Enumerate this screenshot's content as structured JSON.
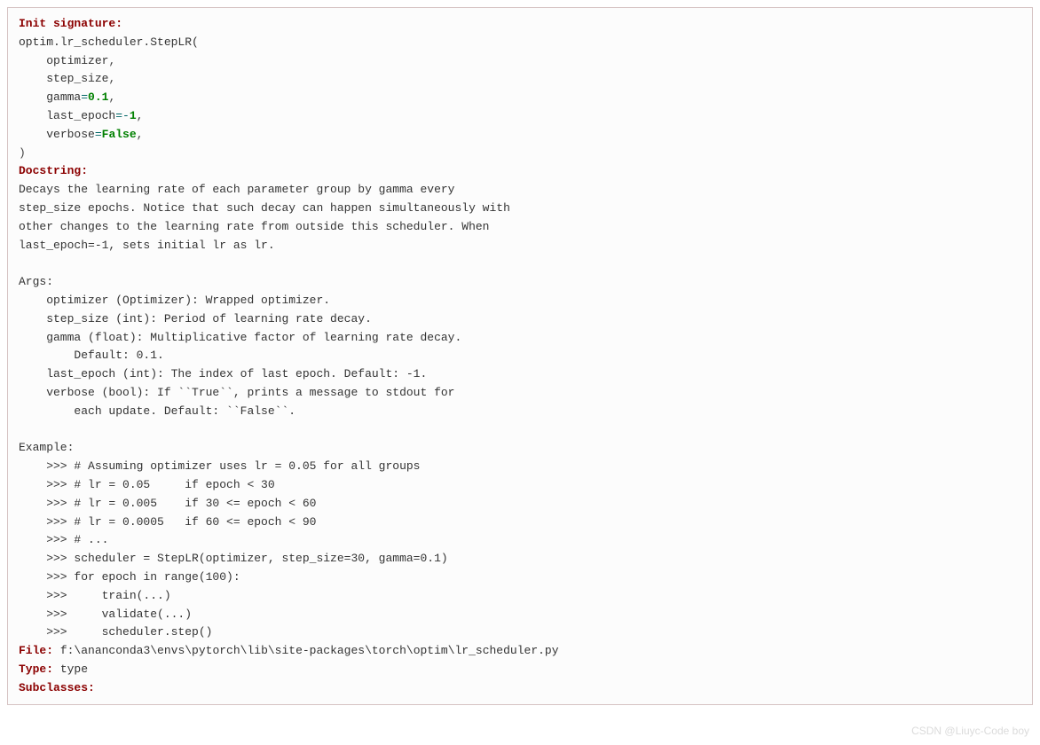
{
  "sections": {
    "init_signature": "Init signature:",
    "docstring": "Docstring:",
    "file": "File:",
    "type": "Type:",
    "subclasses": "Subclasses:"
  },
  "signature": {
    "prefix": "optim.",
    "call": "lr_scheduler.StepLR(",
    "params": [
      {
        "name": "optimizer",
        "eq": "",
        "value": "",
        "suffix": ","
      },
      {
        "name": "step_size",
        "eq": "",
        "value": "",
        "suffix": ","
      },
      {
        "name": "gamma",
        "eq": "=",
        "value": "0.1",
        "suffix": ","
      },
      {
        "name": "last_epoch",
        "eq": "=",
        "value": "-1",
        "op": "-",
        "num": "1",
        "suffix": ","
      },
      {
        "name": "verbose",
        "eq": "=",
        "value": "False",
        "suffix": ","
      }
    ],
    "close": ")"
  },
  "docstring_body": [
    "Decays the learning rate of each parameter group by gamma every",
    "step_size epochs. Notice that such decay can happen simultaneously with",
    "other changes to the learning rate from outside this scheduler. When",
    "last_epoch=-1, sets initial lr as lr.",
    "",
    "Args:",
    "    optimizer (Optimizer): Wrapped optimizer.",
    "    step_size (int): Period of learning rate decay.",
    "    gamma (float): Multiplicative factor of learning rate decay.",
    "        Default: 0.1.",
    "    last_epoch (int): The index of last epoch. Default: -1.",
    "    verbose (bool): If ``True``, prints a message to stdout for",
    "        each update. Default: ``False``.",
    "",
    "Example:",
    "    >>> # Assuming optimizer uses lr = 0.05 for all groups",
    "    >>> # lr = 0.05     if epoch < 30",
    "    >>> # lr = 0.005    if 30 <= epoch < 60",
    "    >>> # lr = 0.0005   if 60 <= epoch < 90",
    "    >>> # ...",
    "    >>> scheduler = StepLR(optimizer, step_size=30, gamma=0.1)",
    "    >>> for epoch in range(100):",
    "    >>>     train(...)",
    "    >>>     validate(...)",
    "    >>>     scheduler.step()"
  ],
  "file_value": "f:\\ananconda3\\envs\\pytorch\\lib\\site-packages\\torch\\optim\\lr_scheduler.py",
  "type_value": "type",
  "subclasses_value": "",
  "watermark": "CSDN @Liuyc-Code boy"
}
